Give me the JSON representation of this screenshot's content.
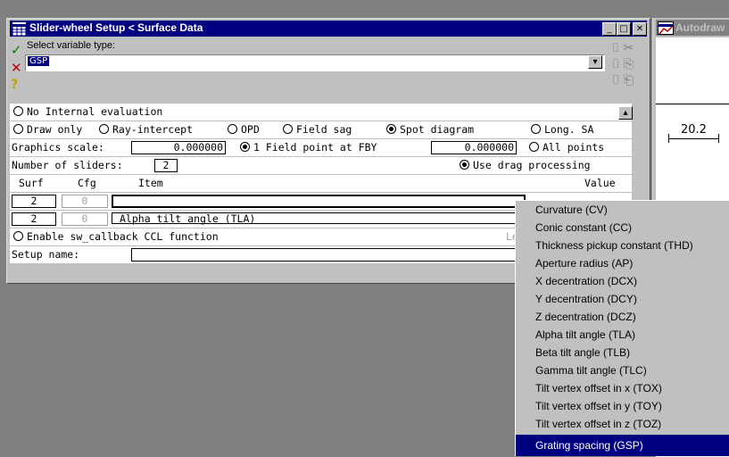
{
  "window": {
    "title": "Slider-wheel Setup < Surface Data",
    "min_label": "_",
    "max_label": "□",
    "close_label": "✕"
  },
  "right_window": {
    "title": "Autodraw",
    "dimension_label": "20.2"
  },
  "header": {
    "select_label": "Select variable type:",
    "select_value": "GSP"
  },
  "options": {
    "no_internal": "No Internal evaluation",
    "draw_only": "Draw only",
    "ray_intercept": "Ray-intercept",
    "opd": "OPD",
    "field_sag": "Field sag",
    "spot_diagram": "Spot diagram",
    "long_sa": "Long. SA",
    "graphics_scale_label": "Graphics scale:",
    "graphics_scale_value": "0.000000",
    "field_point_label": "1 Field point at FBY",
    "field_point_value": "0.000000",
    "all_points": "All points",
    "num_sliders_label": "Number of sliders:",
    "num_sliders_value": "2",
    "use_drag": "Use drag processing"
  },
  "table": {
    "col_surf": "Surf",
    "col_cfg": "Cfg",
    "col_item": "Item",
    "col_value": "Value",
    "rows": [
      {
        "surf": "2",
        "cfg": "0",
        "item": ""
      },
      {
        "surf": "2",
        "cfg": "0",
        "item": "Alpha tilt angle (TLA)"
      }
    ]
  },
  "callback": {
    "label": "Enable sw_callback CCL function",
    "right_partial": "Le"
  },
  "setup_name": {
    "label": "Setup name:",
    "value": ""
  },
  "dropdown": {
    "items": [
      "Curvature (CV)",
      "Conic constant (CC)",
      "Thickness pickup constant (THD)",
      "Aperture radius (AP)",
      "X decentration (DCX)",
      "Y decentration (DCY)",
      "Z decentration (DCZ)",
      "Alpha tilt angle (TLA)",
      "Beta tilt angle (TLB)",
      "Gamma tilt angle (TLC)",
      "Tilt vertex offset in x (TOX)",
      "Tilt vertex offset in y (TOY)",
      "Tilt vertex offset in z (TOZ)",
      "Grating spacing (GSP)"
    ],
    "selected": "Grating spacing (GSP)"
  }
}
